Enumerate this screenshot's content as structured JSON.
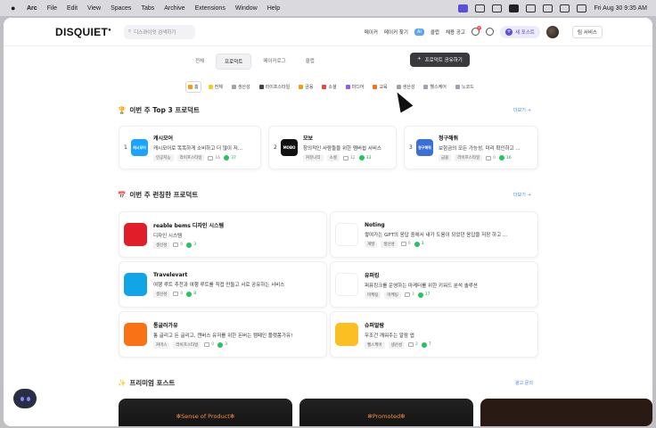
{
  "menubar": {
    "apple": "",
    "items": [
      "Arc",
      "File",
      "Edit",
      "View",
      "Spaces",
      "Tabs",
      "Archive",
      "Extensions",
      "Window",
      "Help"
    ],
    "clock": "Fri Aug 30  9:35 AM"
  },
  "topnav": {
    "logo": "DISQUIET",
    "search_placeholder": "디스콰이엇 검색하기",
    "links": [
      "메이커",
      "메이커 찾기",
      "클럽",
      "채용 공고"
    ],
    "ai_badge": "AI",
    "notif_count": "1",
    "new_post": "새 포스트",
    "team_service": "팀 서비스"
  },
  "tabs": [
    "전체",
    "프로덕트",
    "메이커로그",
    "클럽"
  ],
  "active_tab": 1,
  "share_button": "프로덕트 공유하기",
  "share_plus": "+",
  "categories": [
    {
      "label": "홈",
      "color": "#f59e0b"
    },
    {
      "label": "전체",
      "color": "#facc15"
    },
    {
      "label": "생산성",
      "color": "#a3a3a3"
    },
    {
      "label": "라이프스타일",
      "color": "#444444"
    },
    {
      "label": "금융",
      "color": "#f59e0b"
    },
    {
      "label": "소셜",
      "color": "#ef4444"
    },
    {
      "label": "미디어",
      "color": "#8b5cf6"
    },
    {
      "label": "교육",
      "color": "#f97316"
    },
    {
      "label": "생산성",
      "color": "#9ca3af"
    },
    {
      "label": "헬스케어",
      "color": "#9ca3af"
    },
    {
      "label": "노코드",
      "color": "#9ca3af"
    }
  ],
  "top3": {
    "title": "이번 주 Top 3 프로덕트",
    "icon": "trophy-icon",
    "more": "더보기 →",
    "items": [
      {
        "rank": "1",
        "name": "캐시모어",
        "desc": "캐시모어로 똑똑하게 소비하고 더 많이 저...",
        "tags": [
          "인공지능",
          "라이프스타일"
        ],
        "comments": "16",
        "upvotes": "37",
        "thumb_color": "#1aa3ff",
        "thumb_text": "캐시모어"
      },
      {
        "rank": "2",
        "name": "모보",
        "desc": "창의적인 사람들을 위한 멤버쉽 서비스",
        "tags": [
          "커뮤니티",
          "소셜"
        ],
        "comments": "12",
        "upvotes": "33",
        "thumb_color": "#111111",
        "thumb_text": "MOBO"
      },
      {
        "rank": "3",
        "name": "청구해줘",
        "desc": "보험금의 모든 가능성, 미리 확인하고 ...",
        "tags": [
          "금융",
          "라이프스타일"
        ],
        "comments": "0",
        "upvotes": "16",
        "thumb_color": "#3b6fd8",
        "thumb_text": "청구해줘"
      }
    ]
  },
  "trending": {
    "title": "이번 주 런칭한 프로덕트",
    "icon": "calendar-icon",
    "more": "더보기 →",
    "items": [
      {
        "name": "reable bems 디자인 시스템",
        "desc": "디자인 시스템",
        "tags": [
          "생산성"
        ],
        "comments": "0",
        "upvotes": "3",
        "thumb_color": "#e11d2a"
      },
      {
        "name": "Noting",
        "desc": "쌓여가는 GPT의 응답 중에서 내가 도움이 되었던 응답을 저장 하고 ...",
        "tags": [
          "개발",
          "생산성"
        ],
        "comments": "0",
        "upvotes": "3",
        "thumb_color": "#ffffff"
      },
      {
        "name": "Travelevart",
        "desc": "여행 루트 추천과 여행 루트를 직접 만들고 서로 공유하는 서비스",
        "tags": [
          "생산성"
        ],
        "comments": "0",
        "upvotes": "8",
        "thumb_color": "#12a5e6"
      },
      {
        "name": "유퍼킹",
        "desc": "퍼퓨킹크를 운영하는 마케터를 위한 키워드 분석 솔루션",
        "tags": [
          "마케팅",
          "마케팅"
        ],
        "comments": "3",
        "upvotes": "17",
        "thumb_color": "#ffffff"
      },
      {
        "name": "통글러가유",
        "desc": "통 글리고 돈 글리고, 캔버스 유저를 위한 돈버는 캠페인 플랫폼가유!",
        "tags": [
          "커머스",
          "라이프스타일"
        ],
        "comments": "0",
        "upvotes": "3",
        "thumb_color": "#f97316"
      },
      {
        "name": "슈퍼알람",
        "desc": "무조건 깨워주는 알람 앱",
        "tags": [
          "헬스케어",
          "생산성"
        ],
        "comments": "2",
        "upvotes": "7",
        "thumb_color": "#fbbf24"
      }
    ]
  },
  "premium": {
    "title": "프리미엄 포스트",
    "icon": "sparkle-icon",
    "more": "광고 문의",
    "cards": [
      "Sense of Product",
      "Promoted",
      ""
    ]
  }
}
